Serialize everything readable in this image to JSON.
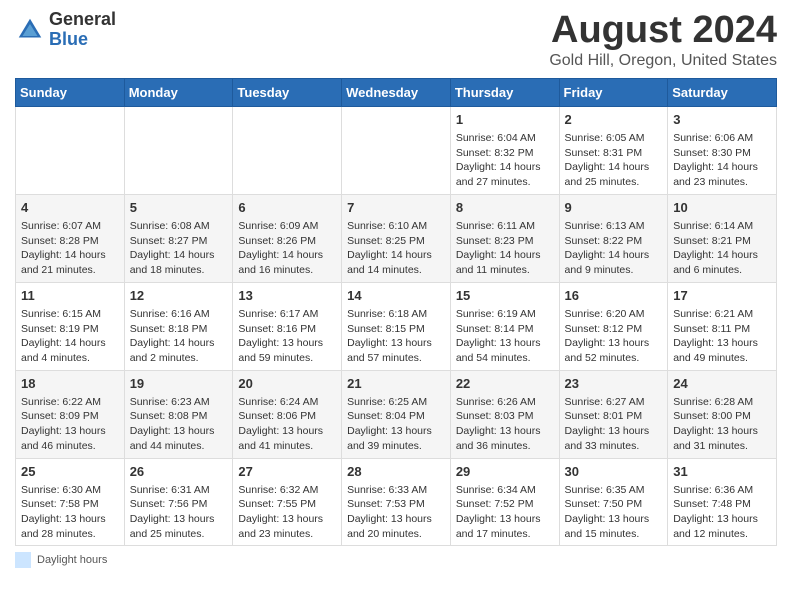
{
  "header": {
    "logo_general": "General",
    "logo_blue": "Blue",
    "title": "August 2024",
    "subtitle": "Gold Hill, Oregon, United States"
  },
  "days_of_week": [
    "Sunday",
    "Monday",
    "Tuesday",
    "Wednesday",
    "Thursday",
    "Friday",
    "Saturday"
  ],
  "weeks": [
    [
      {
        "day": "",
        "sunrise": "",
        "sunset": "",
        "daylight": ""
      },
      {
        "day": "",
        "sunrise": "",
        "sunset": "",
        "daylight": ""
      },
      {
        "day": "",
        "sunrise": "",
        "sunset": "",
        "daylight": ""
      },
      {
        "day": "",
        "sunrise": "",
        "sunset": "",
        "daylight": ""
      },
      {
        "day": "1",
        "sunrise": "Sunrise: 6:04 AM",
        "sunset": "Sunset: 8:32 PM",
        "daylight": "Daylight: 14 hours and 27 minutes."
      },
      {
        "day": "2",
        "sunrise": "Sunrise: 6:05 AM",
        "sunset": "Sunset: 8:31 PM",
        "daylight": "Daylight: 14 hours and 25 minutes."
      },
      {
        "day": "3",
        "sunrise": "Sunrise: 6:06 AM",
        "sunset": "Sunset: 8:30 PM",
        "daylight": "Daylight: 14 hours and 23 minutes."
      }
    ],
    [
      {
        "day": "4",
        "sunrise": "Sunrise: 6:07 AM",
        "sunset": "Sunset: 8:28 PM",
        "daylight": "Daylight: 14 hours and 21 minutes."
      },
      {
        "day": "5",
        "sunrise": "Sunrise: 6:08 AM",
        "sunset": "Sunset: 8:27 PM",
        "daylight": "Daylight: 14 hours and 18 minutes."
      },
      {
        "day": "6",
        "sunrise": "Sunrise: 6:09 AM",
        "sunset": "Sunset: 8:26 PM",
        "daylight": "Daylight: 14 hours and 16 minutes."
      },
      {
        "day": "7",
        "sunrise": "Sunrise: 6:10 AM",
        "sunset": "Sunset: 8:25 PM",
        "daylight": "Daylight: 14 hours and 14 minutes."
      },
      {
        "day": "8",
        "sunrise": "Sunrise: 6:11 AM",
        "sunset": "Sunset: 8:23 PM",
        "daylight": "Daylight: 14 hours and 11 minutes."
      },
      {
        "day": "9",
        "sunrise": "Sunrise: 6:13 AM",
        "sunset": "Sunset: 8:22 PM",
        "daylight": "Daylight: 14 hours and 9 minutes."
      },
      {
        "day": "10",
        "sunrise": "Sunrise: 6:14 AM",
        "sunset": "Sunset: 8:21 PM",
        "daylight": "Daylight: 14 hours and 6 minutes."
      }
    ],
    [
      {
        "day": "11",
        "sunrise": "Sunrise: 6:15 AM",
        "sunset": "Sunset: 8:19 PM",
        "daylight": "Daylight: 14 hours and 4 minutes."
      },
      {
        "day": "12",
        "sunrise": "Sunrise: 6:16 AM",
        "sunset": "Sunset: 8:18 PM",
        "daylight": "Daylight: 14 hours and 2 minutes."
      },
      {
        "day": "13",
        "sunrise": "Sunrise: 6:17 AM",
        "sunset": "Sunset: 8:16 PM",
        "daylight": "Daylight: 13 hours and 59 minutes."
      },
      {
        "day": "14",
        "sunrise": "Sunrise: 6:18 AM",
        "sunset": "Sunset: 8:15 PM",
        "daylight": "Daylight: 13 hours and 57 minutes."
      },
      {
        "day": "15",
        "sunrise": "Sunrise: 6:19 AM",
        "sunset": "Sunset: 8:14 PM",
        "daylight": "Daylight: 13 hours and 54 minutes."
      },
      {
        "day": "16",
        "sunrise": "Sunrise: 6:20 AM",
        "sunset": "Sunset: 8:12 PM",
        "daylight": "Daylight: 13 hours and 52 minutes."
      },
      {
        "day": "17",
        "sunrise": "Sunrise: 6:21 AM",
        "sunset": "Sunset: 8:11 PM",
        "daylight": "Daylight: 13 hours and 49 minutes."
      }
    ],
    [
      {
        "day": "18",
        "sunrise": "Sunrise: 6:22 AM",
        "sunset": "Sunset: 8:09 PM",
        "daylight": "Daylight: 13 hours and 46 minutes."
      },
      {
        "day": "19",
        "sunrise": "Sunrise: 6:23 AM",
        "sunset": "Sunset: 8:08 PM",
        "daylight": "Daylight: 13 hours and 44 minutes."
      },
      {
        "day": "20",
        "sunrise": "Sunrise: 6:24 AM",
        "sunset": "Sunset: 8:06 PM",
        "daylight": "Daylight: 13 hours and 41 minutes."
      },
      {
        "day": "21",
        "sunrise": "Sunrise: 6:25 AM",
        "sunset": "Sunset: 8:04 PM",
        "daylight": "Daylight: 13 hours and 39 minutes."
      },
      {
        "day": "22",
        "sunrise": "Sunrise: 6:26 AM",
        "sunset": "Sunset: 8:03 PM",
        "daylight": "Daylight: 13 hours and 36 minutes."
      },
      {
        "day": "23",
        "sunrise": "Sunrise: 6:27 AM",
        "sunset": "Sunset: 8:01 PM",
        "daylight": "Daylight: 13 hours and 33 minutes."
      },
      {
        "day": "24",
        "sunrise": "Sunrise: 6:28 AM",
        "sunset": "Sunset: 8:00 PM",
        "daylight": "Daylight: 13 hours and 31 minutes."
      }
    ],
    [
      {
        "day": "25",
        "sunrise": "Sunrise: 6:30 AM",
        "sunset": "Sunset: 7:58 PM",
        "daylight": "Daylight: 13 hours and 28 minutes."
      },
      {
        "day": "26",
        "sunrise": "Sunrise: 6:31 AM",
        "sunset": "Sunset: 7:56 PM",
        "daylight": "Daylight: 13 hours and 25 minutes."
      },
      {
        "day": "27",
        "sunrise": "Sunrise: 6:32 AM",
        "sunset": "Sunset: 7:55 PM",
        "daylight": "Daylight: 13 hours and 23 minutes."
      },
      {
        "day": "28",
        "sunrise": "Sunrise: 6:33 AM",
        "sunset": "Sunset: 7:53 PM",
        "daylight": "Daylight: 13 hours and 20 minutes."
      },
      {
        "day": "29",
        "sunrise": "Sunrise: 6:34 AM",
        "sunset": "Sunset: 7:52 PM",
        "daylight": "Daylight: 13 hours and 17 minutes."
      },
      {
        "day": "30",
        "sunrise": "Sunrise: 6:35 AM",
        "sunset": "Sunset: 7:50 PM",
        "daylight": "Daylight: 13 hours and 15 minutes."
      },
      {
        "day": "31",
        "sunrise": "Sunrise: 6:36 AM",
        "sunset": "Sunset: 7:48 PM",
        "daylight": "Daylight: 13 hours and 12 minutes."
      }
    ]
  ],
  "footer": {
    "daylight_label": "Daylight hours"
  }
}
